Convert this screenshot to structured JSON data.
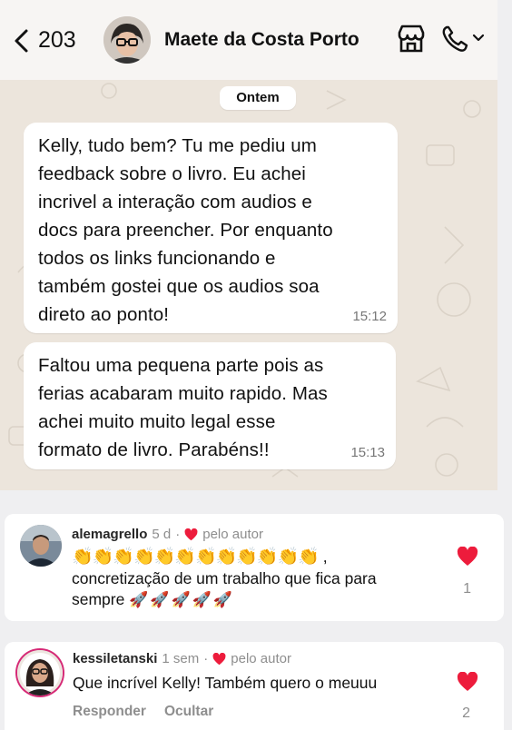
{
  "header": {
    "back_count": "203",
    "contact_name": "Maete da Costa Porto"
  },
  "chat": {
    "date_label": "Ontem",
    "messages": [
      {
        "text": "Kelly, tudo bem? Tu me pediu um\nfeedback sobre o livro. Eu achei\nincrivel a interação com audios e\ndocs para preencher. Por enquanto\ntodos os links funcionando e\ntambém gostei que os audios soa\ndireto ao ponto!",
        "time": "15:12"
      },
      {
        "text": "Faltou uma pequena parte pois as\nferias acabaram muito rapido. Mas\nachei muito muito legal esse\nformato de livro. Parabéns!!",
        "time": "15:13"
      }
    ]
  },
  "comments": [
    {
      "username": "alemagrello",
      "age": "5 d",
      "dot": "·",
      "author_label": "pelo autor",
      "claps": "👏👏👏👏👏👏👏👏👏👏👏👏",
      "claps_suffix": " ,",
      "text": "concretização de um trabalho que fica para",
      "text2": "sempre ",
      "rockets": "🚀🚀🚀🚀🚀",
      "likes": "1"
    },
    {
      "username": "kessiletanski",
      "age": "1 sem",
      "dot": "·",
      "author_label": "pelo autor",
      "text": "Que incrível Kelly! Também quero o meuuu",
      "reply_label": "Responder",
      "hide_label": "Ocultar",
      "likes": "2"
    }
  ],
  "colors": {
    "heart": "#ed1c3c",
    "chat_bg": "#ece5dc",
    "header_bg": "#f7f5f3"
  },
  "icons": [
    "chevron-left-icon",
    "store-icon",
    "phone-icon",
    "chevron-down-icon",
    "heart-icon"
  ]
}
